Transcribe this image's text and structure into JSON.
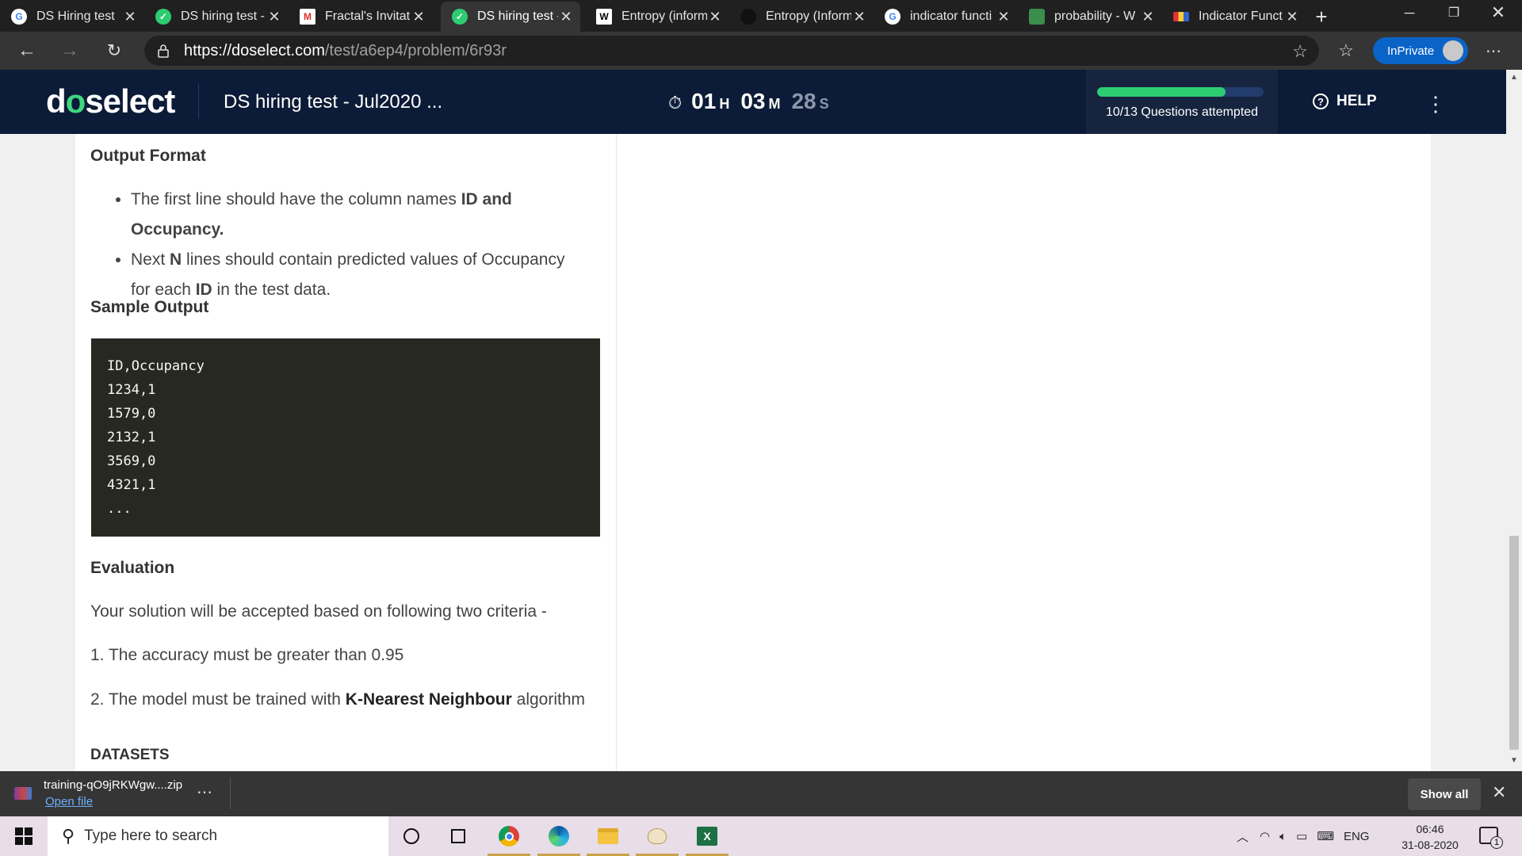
{
  "browser": {
    "tabs": [
      {
        "title": "DS Hiring test",
        "icon": "google-icon",
        "active": false
      },
      {
        "title": "DS hiring test -",
        "icon": "doselect-check-icon",
        "active": false
      },
      {
        "title": "Fractal's Invitat",
        "icon": "gmail-icon",
        "active": false
      },
      {
        "title": "DS hiring test -",
        "icon": "doselect-check-icon",
        "active": true
      },
      {
        "title": "Entropy (inform",
        "icon": "wikipedia-icon",
        "active": false
      },
      {
        "title": "Entropy (Inform",
        "icon": "github-icon",
        "active": false
      },
      {
        "title": "indicator functi",
        "icon": "google-icon",
        "active": false
      },
      {
        "title": "probability - W",
        "icon": "stackexchange-icon",
        "active": false
      },
      {
        "title": "Indicator Funct",
        "icon": "site-icon",
        "active": false
      }
    ],
    "url_host": "https://doselect.com",
    "url_path": "/test/a6ep4/problem/6r93r",
    "inprivate_label": "InPrivate"
  },
  "app": {
    "logo_pre": "d",
    "logo_o": "o",
    "logo_post": "select",
    "test_title": "DS hiring test - Jul2020 ...",
    "timer": {
      "hours": "01",
      "h_unit": "H",
      "minutes": "03",
      "m_unit": "M",
      "seconds": "28",
      "s_unit": "S"
    },
    "progress": {
      "label": "10/13 Questions attempted",
      "attempted": 10,
      "total": 13
    },
    "help_label": "HELP",
    "accent": "#2ecc71",
    "header_bg": "#0c1b37"
  },
  "problem": {
    "output_format_heading": "Output Format",
    "bullet1_pre": "The first line should have the column names ",
    "bullet1_bold": "ID and Occupancy.",
    "bullet2_pre": "Next ",
    "bullet2_bold1": "N",
    "bullet2_mid": " lines should contain predicted values of Occupancy for each ",
    "bullet2_bold2": "ID",
    "bullet2_post": " in the test data.",
    "sample_output_heading": "Sample Output",
    "sample_lines": [
      "ID,Occupancy",
      "1234,1",
      "1579,0",
      "2132,1",
      "3569,0",
      "4321,1",
      "..."
    ],
    "evaluation_heading": "Evaluation",
    "evaluation_intro": "Your solution will be accepted based on following two criteria -",
    "criterion1": "1. The accuracy must be greater than 0.95",
    "criterion2_pre": "2. The model must be trained with ",
    "criterion2_bold": "K-Nearest Neighbour",
    "criterion2_post": " algorithm",
    "datasets_heading": "DATASETS"
  },
  "download": {
    "filename": "training-qO9jRKWgw....zip",
    "open_label": "Open file",
    "show_all_label": "Show all"
  },
  "taskbar": {
    "search_placeholder": "Type here to search",
    "lang": "ENG",
    "time": "06:46",
    "date": "31-08-2020",
    "notification_count": "1"
  }
}
